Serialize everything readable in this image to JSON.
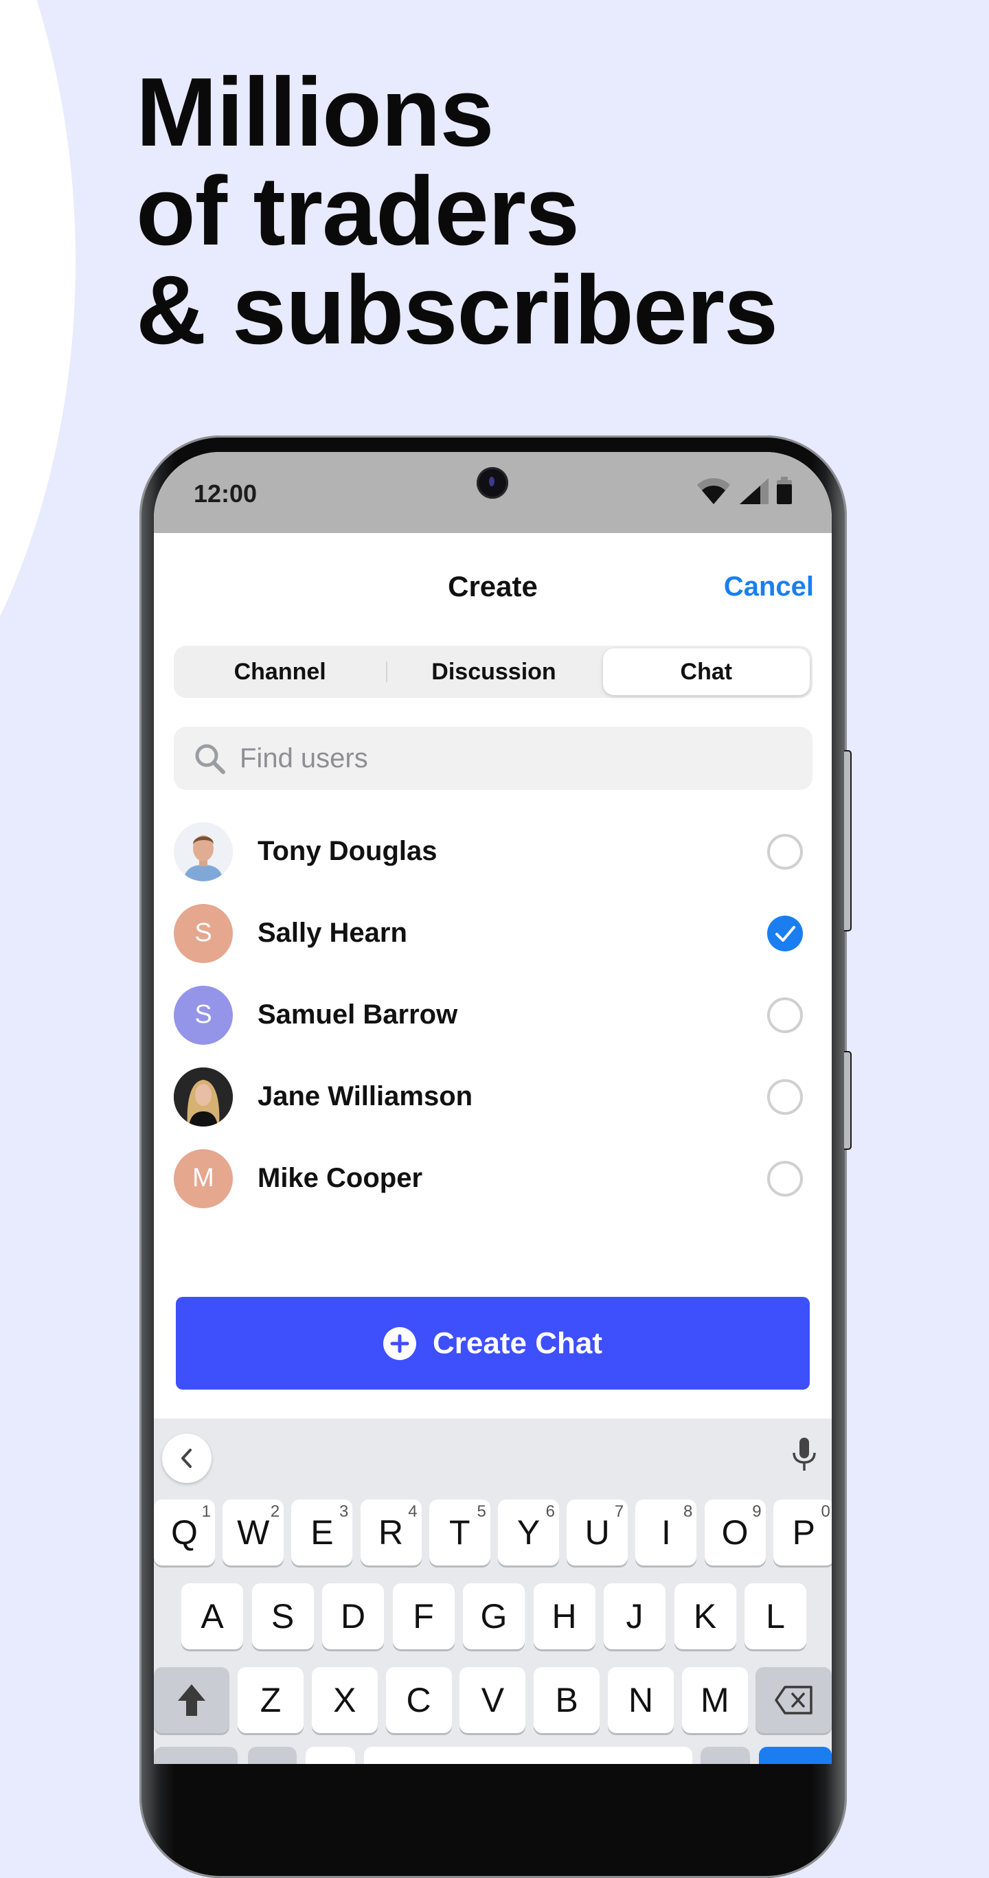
{
  "headline": [
    "Millions",
    "of traders",
    "& subscribers"
  ],
  "status_bar": {
    "time": "12:00"
  },
  "header": {
    "title": "Create",
    "cancel_label": "Cancel"
  },
  "tabs": [
    {
      "label": "Channel",
      "active": false
    },
    {
      "label": "Discussion",
      "active": false
    },
    {
      "label": "Chat",
      "active": true
    }
  ],
  "search": {
    "placeholder": "Find users",
    "value": ""
  },
  "users": [
    {
      "name": "Tony Douglas",
      "avatar_type": "photo",
      "initial": "",
      "avatar_color": "#dfe6ee",
      "selected": false
    },
    {
      "name": "Sally Hearn",
      "avatar_type": "initial",
      "initial": "S",
      "avatar_color": "#e5a78e",
      "selected": true
    },
    {
      "name": "Samuel Barrow",
      "avatar_type": "initial",
      "initial": "S",
      "avatar_color": "#9494e8",
      "selected": false
    },
    {
      "name": "Jane Williamson",
      "avatar_type": "photo",
      "initial": "",
      "avatar_color": "#1c1c1c",
      "selected": false
    },
    {
      "name": "Mike Cooper",
      "avatar_type": "initial",
      "initial": "M",
      "avatar_color": "#e5a78e",
      "selected": false
    }
  ],
  "create_button": {
    "label": "Create Chat",
    "icon": "plus-circle-icon"
  },
  "keyboard": {
    "row1": [
      {
        "k": "Q",
        "n": "1"
      },
      {
        "k": "W",
        "n": "2"
      },
      {
        "k": "E",
        "n": "3"
      },
      {
        "k": "R",
        "n": "4"
      },
      {
        "k": "T",
        "n": "5"
      },
      {
        "k": "Y",
        "n": "6"
      },
      {
        "k": "U",
        "n": "7"
      },
      {
        "k": "I",
        "n": "8"
      },
      {
        "k": "O",
        "n": "9"
      },
      {
        "k": "P",
        "n": "0"
      }
    ],
    "row2": [
      "A",
      "S",
      "D",
      "F",
      "G",
      "H",
      "J",
      "K",
      "L"
    ],
    "row3": [
      "Z",
      "X",
      "C",
      "V",
      "B",
      "N",
      "M"
    ]
  },
  "colors": {
    "accent_blue": "#1a7ef0",
    "button_blue": "#3e4ffc",
    "page_bg": "#e8eafd",
    "status_bar": "#b3b3b3",
    "keyboard_bg": "#e8e9ec"
  }
}
